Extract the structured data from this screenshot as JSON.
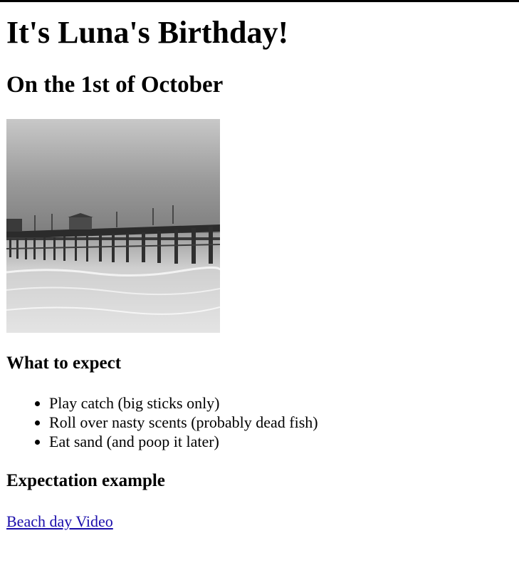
{
  "page": {
    "title": "It's Luna's Birthday!",
    "subtitle": "On the 1st of October"
  },
  "image": {
    "icon": "pier-photo",
    "colors": {
      "sky_top": "#bfbfbf",
      "sky_bottom": "#8a8a8a",
      "pier": "#2a2a2a",
      "water": "#d8d8d8"
    }
  },
  "expect": {
    "heading": "What to expect",
    "items": [
      "Play catch (big sticks only)",
      "Roll over nasty scents (probably dead fish)",
      "Eat sand (and poop it later)"
    ]
  },
  "example": {
    "heading": "Expectation example",
    "link_text": "Beach day Video",
    "link_color": "#1a0dab"
  }
}
